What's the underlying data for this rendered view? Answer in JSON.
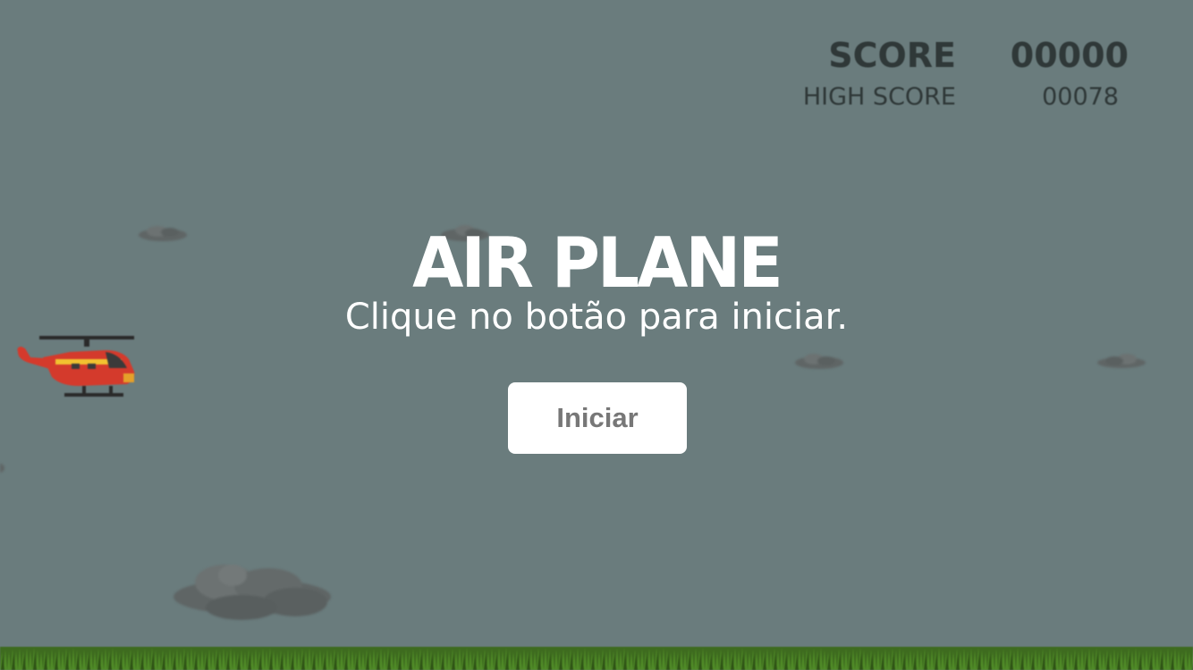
{
  "game": {
    "title": "AIR PLANE",
    "subtitle": "Clique no botão para iniciar.",
    "start_label": "Iniciar"
  },
  "scoreboard": {
    "score_label": "SCORE",
    "score_value": "00000",
    "highscore_label": "HIGH SCORE",
    "highscore_value": "00078"
  },
  "colors": {
    "sky": "#6a7c7d",
    "text_dark": "#2f3838",
    "title": "#ffffff",
    "button_bg": "#ffffff",
    "button_text": "#777777",
    "grass": "#3e6b1f",
    "helicopter_body": "#d43a2c",
    "helicopter_stripe": "#f2c230",
    "cloud": "#5f6565"
  },
  "icons": {
    "player": "helicopter-icon",
    "obstacle": "cloud-icon",
    "ground": "grass-icon"
  }
}
